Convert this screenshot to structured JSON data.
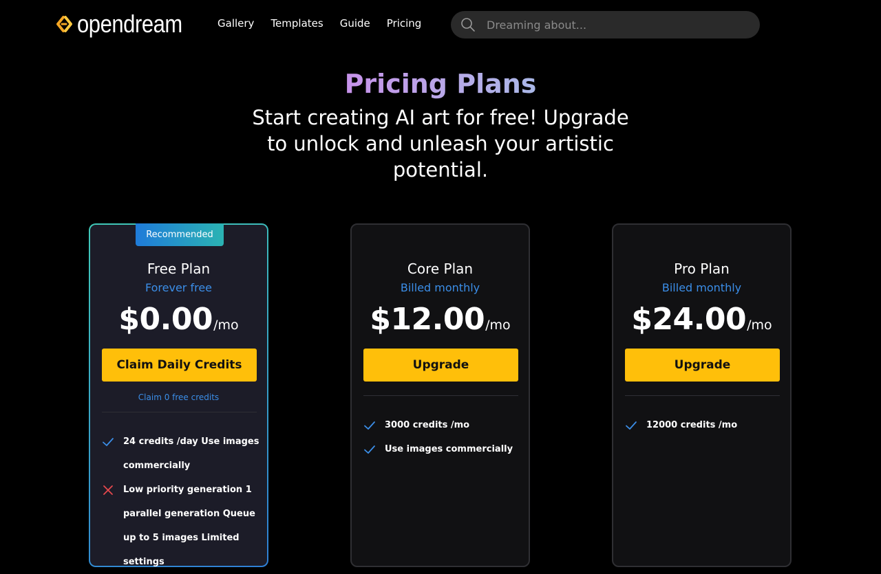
{
  "nav": {
    "logo_text": "opendream",
    "links": [
      {
        "label": "Gallery"
      },
      {
        "label": "Templates"
      },
      {
        "label": "Guide"
      },
      {
        "label": "Pricing"
      }
    ],
    "search": {
      "placeholder": "Dreaming about...",
      "value": ""
    }
  },
  "hero": {
    "title": "Pricing Plans",
    "subtitle": "Start creating AI art for free! Upgrade to unlock and unleash your artistic potential."
  },
  "plans": [
    {
      "badge": "Recommended",
      "name": "Free Plan",
      "billing": "Forever free",
      "price": "$0.00",
      "unit": "/mo",
      "cta": "Claim Daily Credits",
      "note": "Claim 0 free credits",
      "features": [
        {
          "included": true,
          "text": "24 credits /day Use images commercially"
        },
        {
          "included": false,
          "text": "Low priority generation 1 parallel generation Queue up to 5 images Limited settings"
        }
      ]
    },
    {
      "name": "Core Plan",
      "billing": "Billed monthly",
      "price": "$12.00",
      "unit": "/mo",
      "cta": "Upgrade",
      "features": [
        {
          "included": true,
          "text": "3000 credits /mo"
        },
        {
          "included": true,
          "text": "Use images commercially"
        }
      ]
    },
    {
      "name": "Pro Plan",
      "billing": "Billed monthly",
      "price": "$24.00",
      "unit": "/mo",
      "cta": "Upgrade",
      "features": [
        {
          "included": true,
          "text": "12000 credits /mo"
        }
      ]
    }
  ],
  "colors": {
    "accent": "#ffbf0a",
    "link_blue": "#3b8ee8",
    "check_blue": "#3b8ee8",
    "cross_red": "#e5484d",
    "background": "#000000"
  },
  "icons": {
    "logo": "opendream-logo-icon",
    "search": "search-icon",
    "included": "check-icon",
    "excluded": "cross-icon"
  }
}
